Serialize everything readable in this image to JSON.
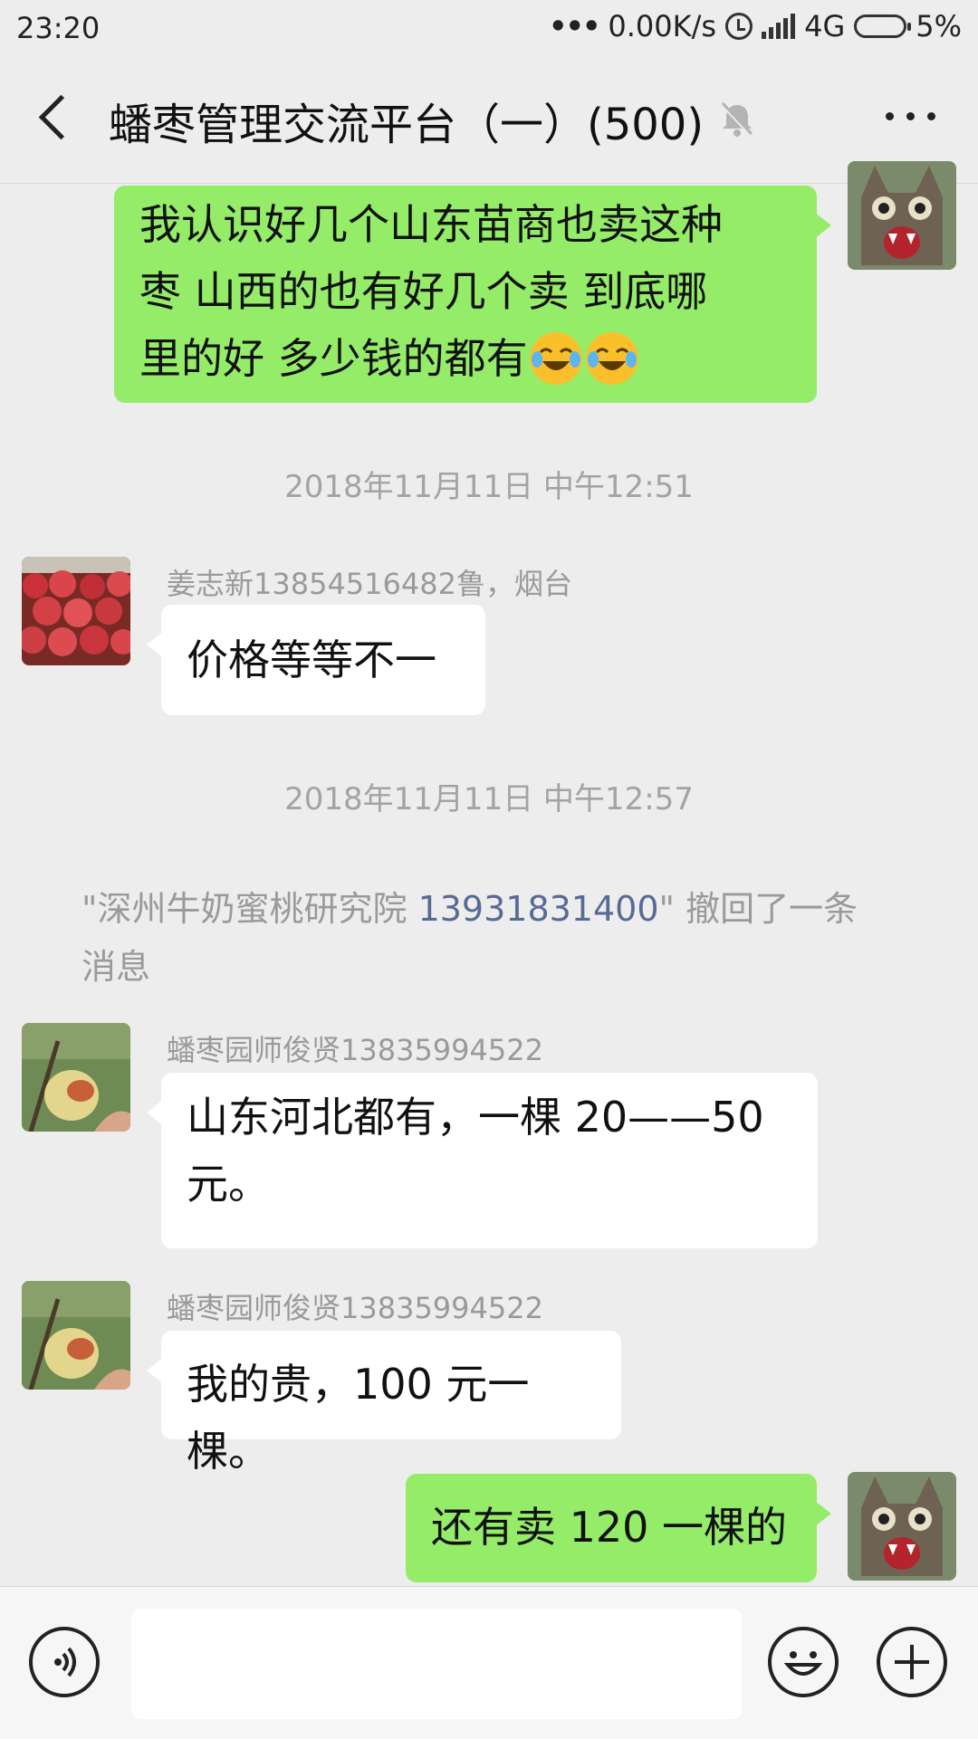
{
  "status_bar": {
    "time": "23:20",
    "dots": "•••",
    "net_speed": "0.00K/s",
    "network": "4G",
    "battery": "5%"
  },
  "header": {
    "title": "蟠枣管理交流平台（一）(500)",
    "icons": [
      "back-arrow-icon",
      "mute-bell-icon",
      "more-icon"
    ]
  },
  "messages": {
    "m1": {
      "text_lines": [
        "我认识好几个山东苗商也卖这种",
        "枣  山西的也有好几个卖  到底哪",
        "里的好  多少钱的都有"
      ],
      "emoji": [
        "crying-laughing-emoji",
        "crying-laughing-emoji"
      ]
    },
    "ts1": "2018年11月11日 中午12:51",
    "m2": {
      "sender": "姜志新13854516482鲁，烟台",
      "text": "价格等等不一"
    },
    "ts2": "2018年11月11日 中午12:57",
    "recall": {
      "prefix": "\"深州牛奶蜜桃研究院 ",
      "number": "13931831400",
      "suffix": "\" 撤回了一条",
      "line2": "消息"
    },
    "m3": {
      "sender": "蟠枣园师俊贤13835994522",
      "line1": "山东河北都有，一棵 20——50",
      "line2": "元。"
    },
    "m4": {
      "sender": "蟠枣园师俊贤13835994522",
      "text": "我的贵，100 元一棵。"
    },
    "m5": {
      "text": "还有卖 120 一棵的"
    }
  },
  "input_bar": {
    "placeholder": "",
    "icons": [
      "voice-icon",
      "emoji-icon",
      "plus-icon"
    ]
  },
  "colors": {
    "background": "#ededed",
    "own_bubble": "#95ec69",
    "other_bubble": "#ffffff",
    "link": "#576b95"
  }
}
